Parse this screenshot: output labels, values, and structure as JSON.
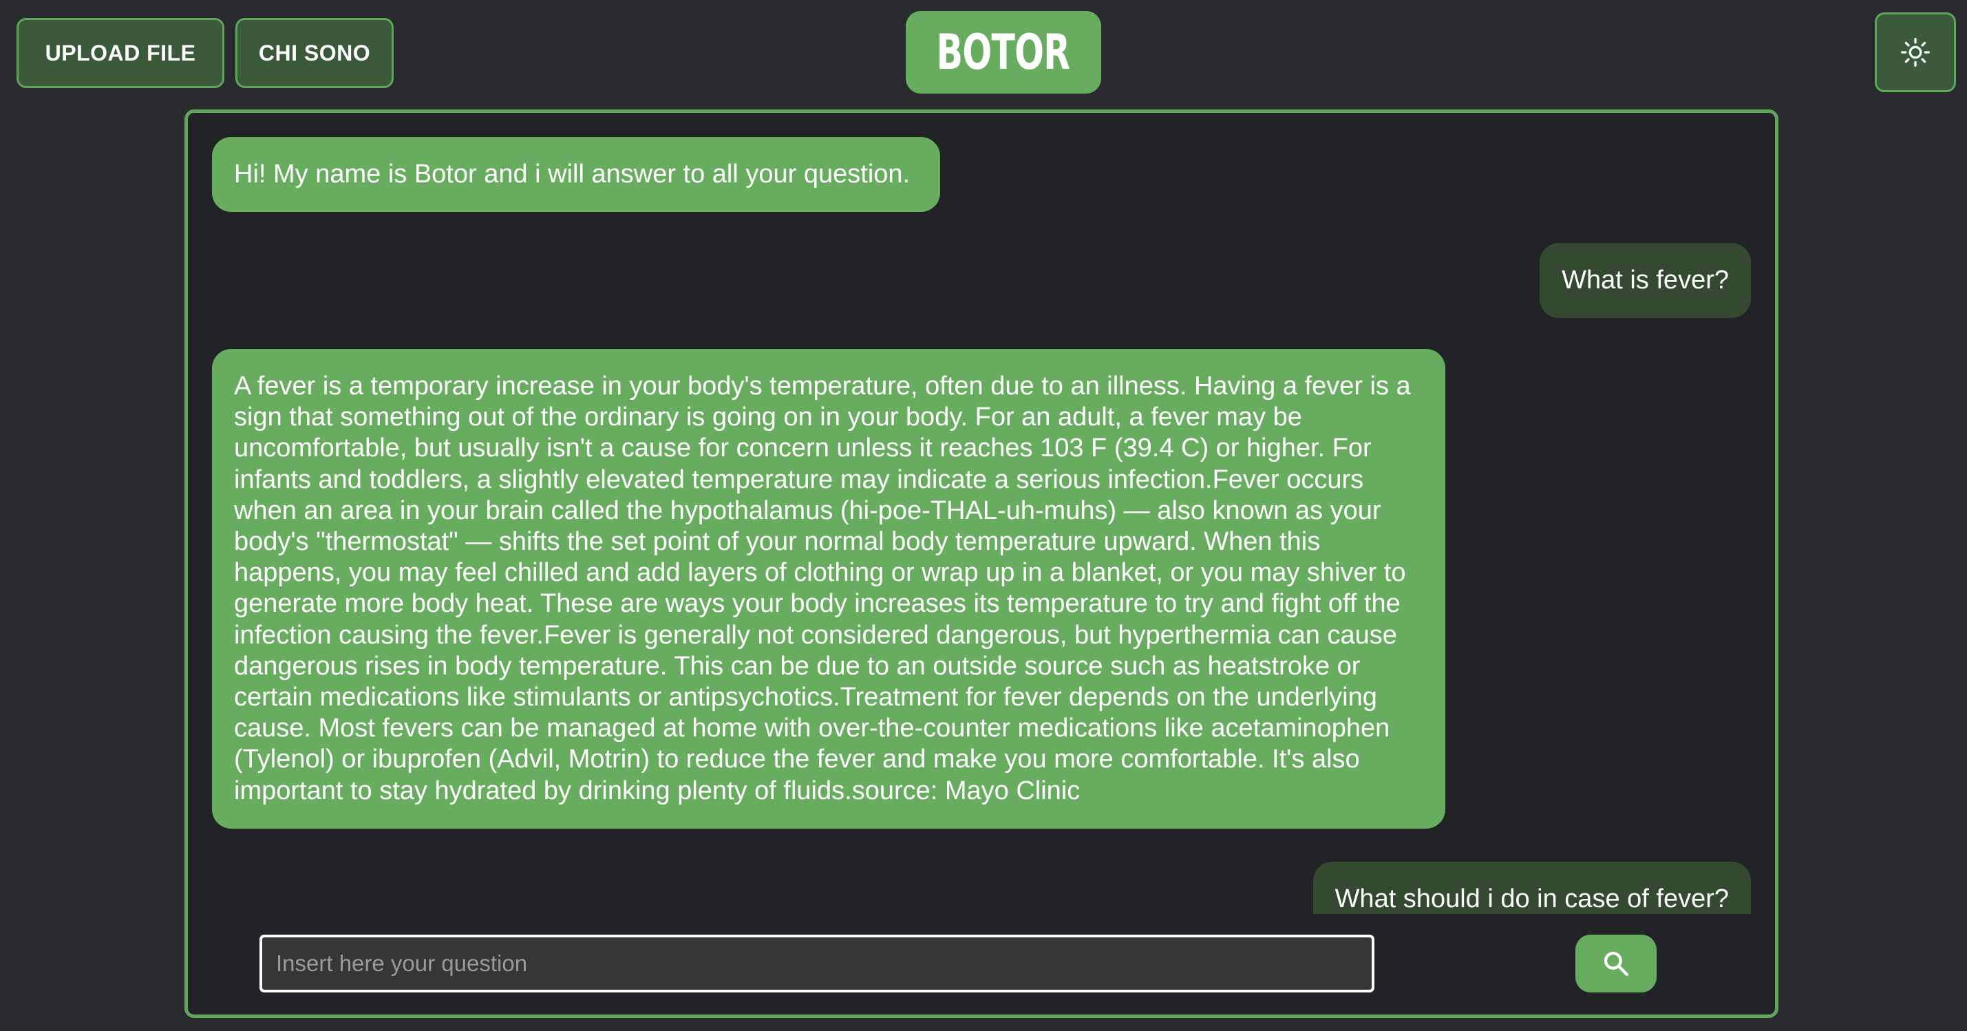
{
  "header": {
    "upload_label": "UPLOAD FILE",
    "whoami_label": "CHI SONO",
    "logo_text": "BOTOR",
    "theme_icon": "sun-icon"
  },
  "chat": {
    "messages": [
      {
        "role": "bot",
        "text": "Hi! My name is Botor and i will answer to all your question."
      },
      {
        "role": "user",
        "text": "What is fever?"
      },
      {
        "role": "bot",
        "text": "A fever is a temporary increase in your body's temperature, often due to an illness. Having a fever is a sign that something out of the ordinary is going on in your body. For an adult, a fever may be uncomfortable, but usually isn't a cause for concern unless it reaches 103 F (39.4 C) or higher. For infants and toddlers, a slightly elevated temperature may indicate a serious infection.Fever occurs when an area in your brain called the hypothalamus (hi-poe-THAL-uh-muhs) — also known as your body's \"thermostat\" — shifts the set point of your normal body temperature upward. When this happens, you may feel chilled and add layers of clothing or wrap up in a blanket, or you may shiver to generate more body heat. These are ways your body increases its temperature to try and fight off the infection causing the fever.Fever is generally not considered dangerous, but hyperthermia can cause dangerous rises in body temperature. This can be due to an outside source such as heatstroke or certain medications like stimulants or antipsychotics.Treatment for fever depends on the underlying cause. Most fevers can be managed at home with over-the-counter medications like acetaminophen (Tylenol) or ibuprofen (Advil, Motrin) to reduce the fever and make you more comfortable. It's also important to stay hydrated by drinking plenty of fluids.source: Mayo Clinic"
      },
      {
        "role": "user",
        "text": "What should i do in case of fever?"
      }
    ]
  },
  "input": {
    "placeholder": "Insert here your question",
    "value": "",
    "search_icon": "search-icon"
  },
  "colors": {
    "background": "#282a2e",
    "panel": "#222327",
    "accent": "#68ad5f",
    "user_bubble": "#334a31",
    "button_bg": "#3b5a3a"
  }
}
